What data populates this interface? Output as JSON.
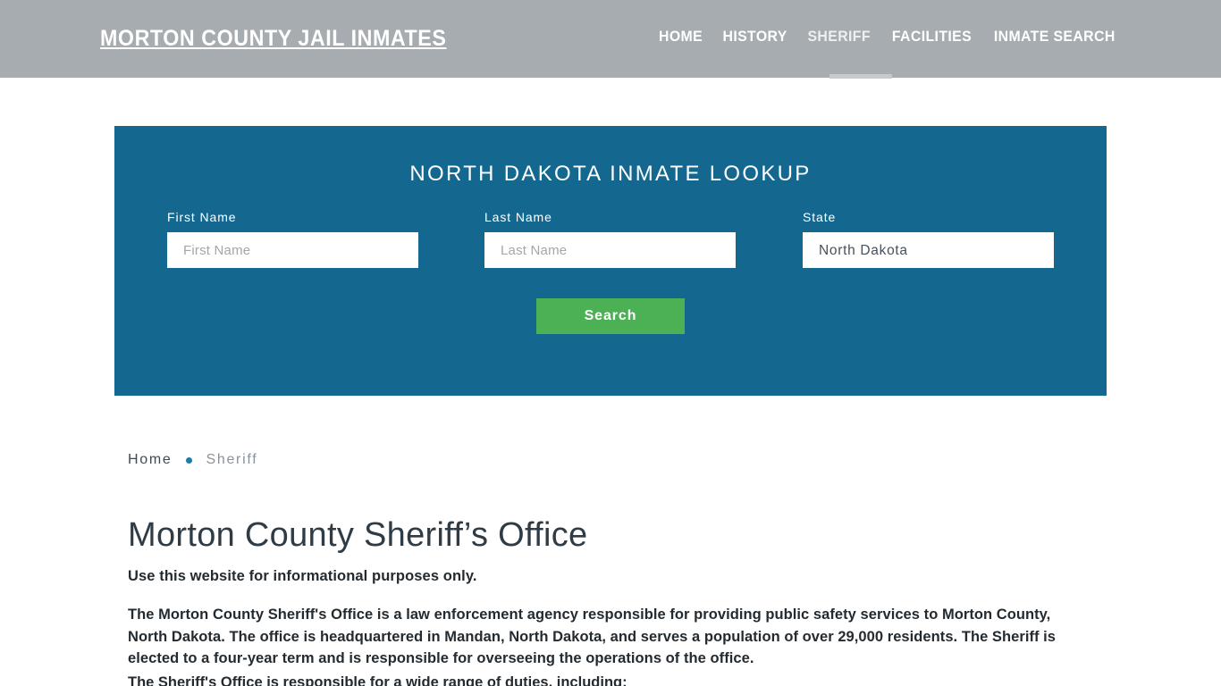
{
  "header": {
    "brand": "Morton County Jail Inmates",
    "nav": [
      {
        "label": "Home",
        "active": false
      },
      {
        "label": "History",
        "active": false
      },
      {
        "label": "Sheriff",
        "active": true
      },
      {
        "label": "Facilities",
        "active": false
      },
      {
        "label": "Inmate Search",
        "active": false
      }
    ],
    "background_color": "#a6acaf",
    "active_indicator_color": "#c5cacc"
  },
  "lookup": {
    "title": "North Dakota Inmate Lookup",
    "panel_color": "#14688f",
    "first_name": {
      "label": "First Name",
      "placeholder": "First Name",
      "value": ""
    },
    "last_name": {
      "label": "Last Name",
      "placeholder": "Last Name",
      "value": ""
    },
    "state": {
      "label": "State",
      "selected": "North Dakota",
      "options": [
        "North Dakota"
      ]
    },
    "search_button": {
      "label": "Search",
      "color": "#4cb155"
    }
  },
  "breadcrumb": {
    "home": "Home",
    "current": "Sheriff",
    "separator_color": "#1c7da3"
  },
  "content": {
    "title": "Morton County Sheriff’s Office",
    "lede": "Use this website for informational purposes only.",
    "paragraph": "The Morton County Sheriff's Office is a law enforcement agency responsible for providing public safety services to Morton County, North Dakota. The office is headquartered in Mandan, North Dakota, and serves a population of over 29,000 residents. The Sheriff is elected to a four-year term and is responsible for overseeing the operations of the office.",
    "paragraph_partial": "The Sheriff's Office is responsible for a wide range of duties, including:"
  }
}
